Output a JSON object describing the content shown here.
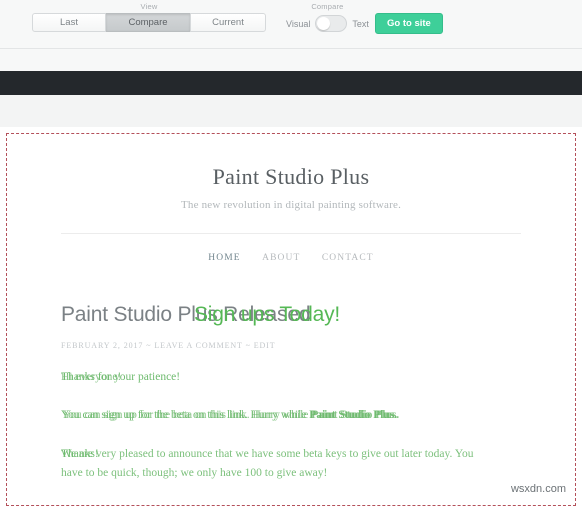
{
  "toolbar": {
    "view_caption": "View",
    "compare_caption": "Compare",
    "view_buttons": [
      {
        "label": "Last",
        "active": false
      },
      {
        "label": "Compare",
        "active": true
      },
      {
        "label": "Current",
        "active": false
      }
    ],
    "toggle_left_label": "Visual",
    "toggle_right_label": "Text",
    "toggle_state": "Visual",
    "go_to_site_label": "Go to site",
    "accent_color": "#3ecf99"
  },
  "selection": {
    "tag": "SELECTION",
    "border_color": "#b4505a"
  },
  "site": {
    "title": "Paint Studio Plus",
    "tagline": "The new revolution in digital painting software.",
    "nav": [
      {
        "label": "HOME",
        "active": true
      },
      {
        "label": "ABOUT",
        "active": false
      },
      {
        "label": "CONTACT",
        "active": false
      }
    ],
    "post": {
      "headline_old": "Paint Studio Plus Released",
      "headline_new": "Sign ups Today!",
      "meta": "FEBRUARY 2, 2017 ~ LEAVE A COMMENT ~ EDIT",
      "paragraph1_old": "Hi everyone!",
      "paragraph1_new": "Thanks for your patience!",
      "paragraph2_old": "You can sign up for the beta on this link. Hurry while",
      "paragraph2_new": "You can sign up for the beta on this link. Hurry while",
      "paragraph2_bold": "Paint Studio Plus.",
      "paragraph3_old": "Thanks!",
      "paragraph3_new": "We are very pleased to announce that we have some beta keys to give out later today. You have to be quick, though; we only have 100 to give away!"
    }
  },
  "watermark": "wsxdn.com",
  "colors": {
    "old_text": "#7b8185",
    "new_text": "#55b855",
    "dark_band": "#24282c"
  }
}
